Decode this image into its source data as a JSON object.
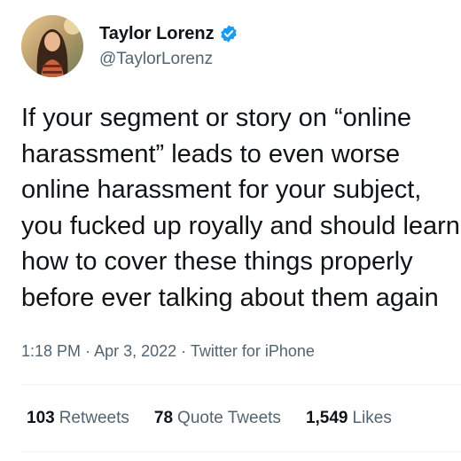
{
  "author": {
    "display_name": "Taylor Lorenz",
    "handle": "@TaylorLorenz",
    "verified_color": "#1d9bf0"
  },
  "tweet": {
    "lines": [
      "If your segment or story on “online",
      "harassment” leads to even worse",
      "online harassment for your subject,",
      "you fucked up royally and should learn",
      "how to cover these things properly",
      "before ever talking about them again"
    ]
  },
  "meta": {
    "time": "1:18 PM",
    "sep1": "·",
    "date": "Apr 3, 2022",
    "sep2": "·",
    "source": "Twitter for iPhone"
  },
  "stats": {
    "retweets_count": "103",
    "retweets_label": "Retweets",
    "quotes_count": "78",
    "quotes_label": "Quote Tweets",
    "likes_count": "1,549",
    "likes_label": "Likes"
  }
}
